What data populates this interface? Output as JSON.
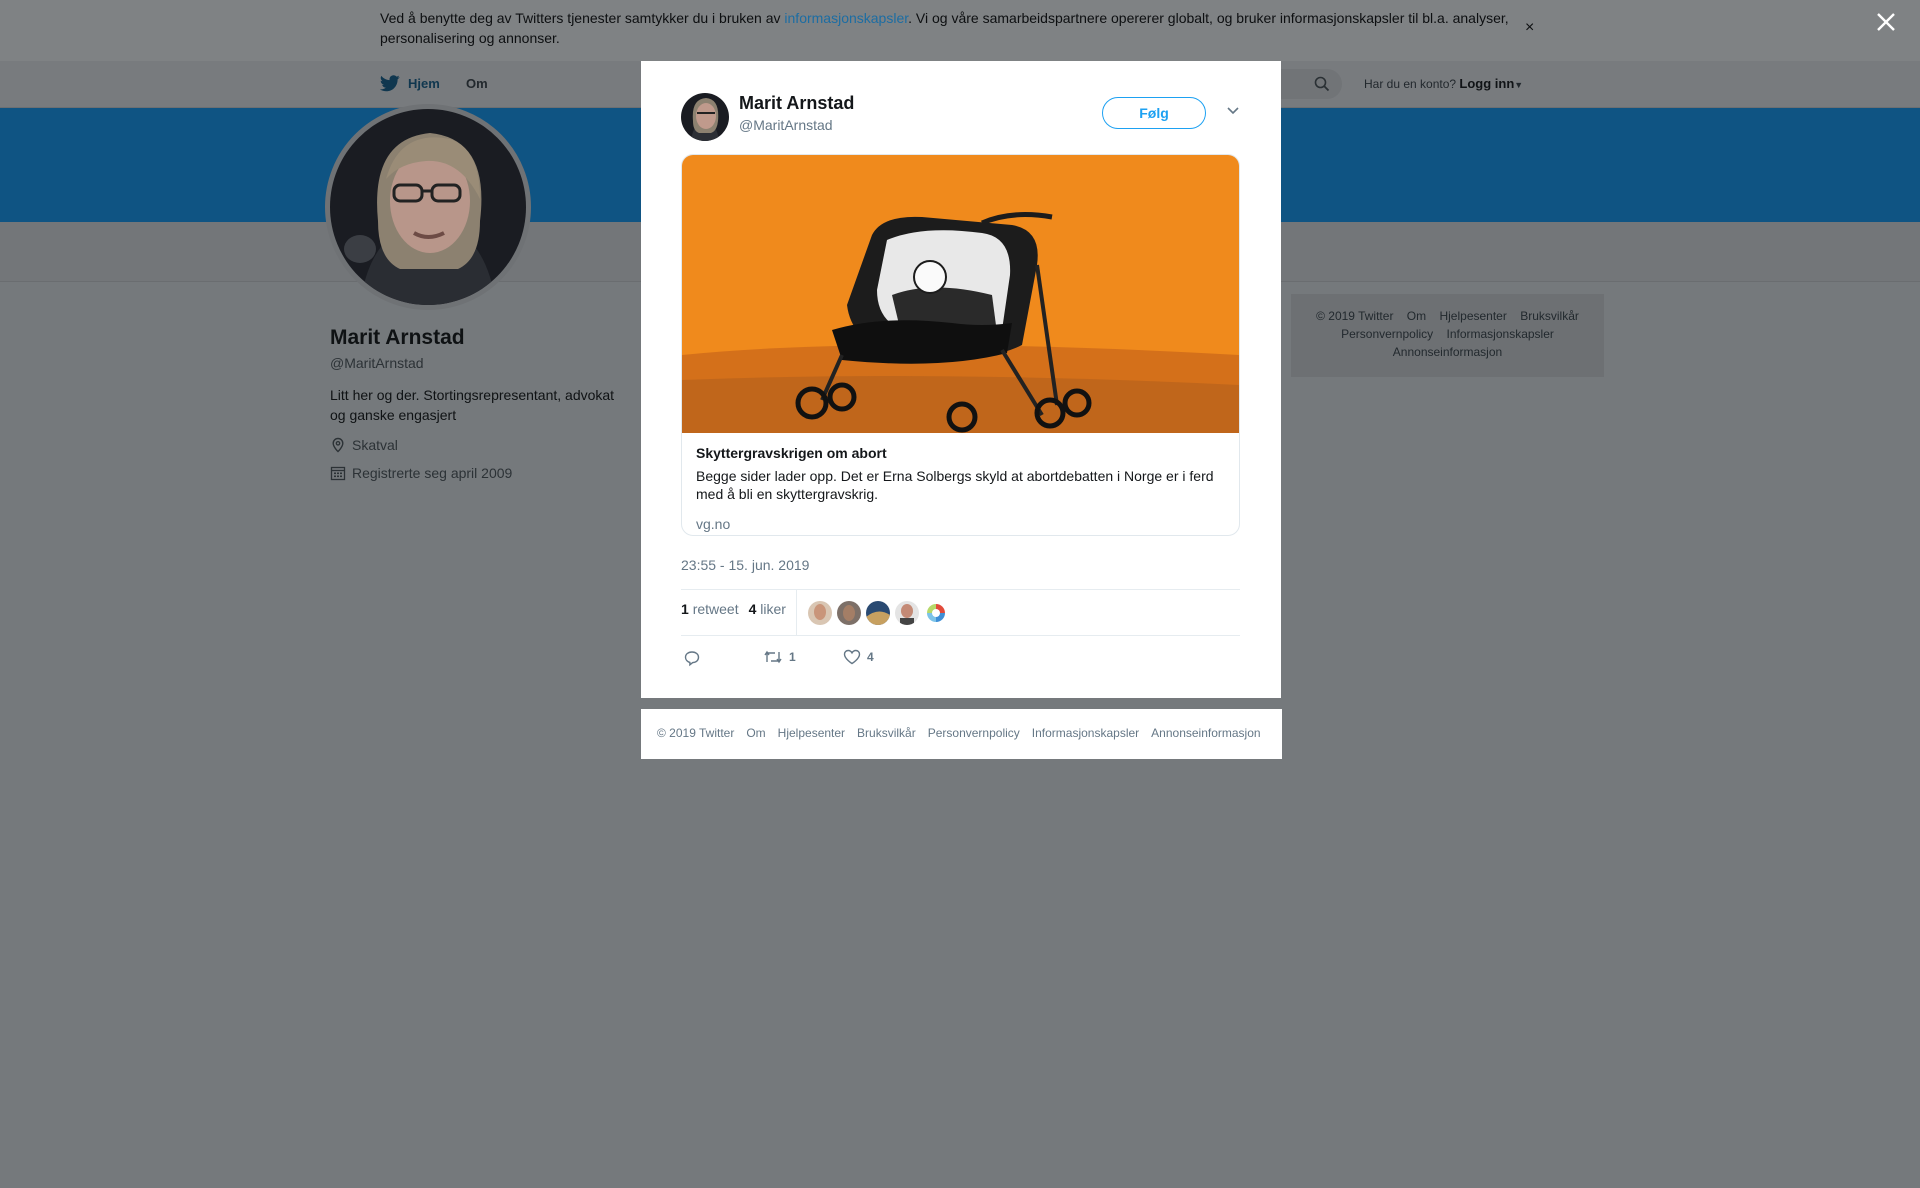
{
  "cookie_bar": {
    "text_before": "Ved å benytte deg av Twitters tjenester samtykker du i bruken av ",
    "link": "informasjonskapsler",
    "text_after": ". Vi og våre samarbeidspartnere opererer globalt, og bruker informasjonskapsler til bl.a. analyser, personalisering og annonser.",
    "close": "×"
  },
  "nav": {
    "home": "Hjem",
    "about": "Om",
    "login_prompt": "Har du en konto?",
    "login": "Logg inn"
  },
  "profile": {
    "name": "Marit Arnstad",
    "handle": "@MaritArnstad",
    "bio": "Litt her og der. Stortingsrepresentant, advokat og ganske engasjert",
    "location": "Skatval",
    "joined": "Registrerte seg april 2009"
  },
  "side_footer": {
    "links": [
      "© 2019 Twitter",
      "Om",
      "Hjelpesenter",
      "Bruksvilkår",
      "Personvernpolicy",
      "Informasjonskapsler",
      "Annonseinformasjon"
    ]
  },
  "tweet": {
    "author_name": "Marit Arnstad",
    "author_handle": "@MaritArnstad",
    "follow": "Følg",
    "card": {
      "title": "Skyttergravskrigen om abort",
      "description": "Begge sider lader opp. Det er Erna Solbergs skyld at abortdebatten i Norge er i ferd med å bli en skyttergravskrig.",
      "domain": "vg.no"
    },
    "timestamp": "23:55 - 15. jun. 2019",
    "retweets_count": "1",
    "retweets_label": "retweet",
    "likes_count": "4",
    "likes_label": "liker",
    "action_retweet_count": "1",
    "action_like_count": "4"
  },
  "modal_footer": {
    "links": [
      "© 2019 Twitter",
      "Om",
      "Hjelpesenter",
      "Bruksvilkår",
      "Personvernpolicy",
      "Informasjonskapsler",
      "Annonseinformasjon"
    ]
  },
  "colors": {
    "accent": "#1da1f2",
    "card_image_bg": "#f08a1c",
    "overlay": "#75797c"
  }
}
